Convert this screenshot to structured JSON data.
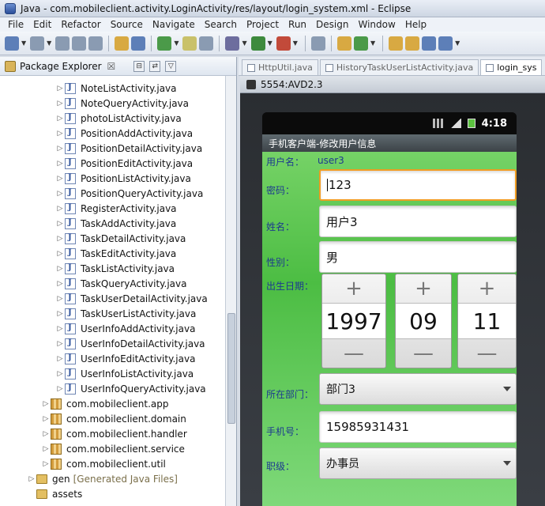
{
  "window": {
    "title": "Java - com.mobileclient.activity.LoginActivity/res/layout/login_system.xml - Eclipse"
  },
  "menu": [
    "File",
    "Edit",
    "Refactor",
    "Source",
    "Navigate",
    "Search",
    "Project",
    "Run",
    "Design",
    "Window",
    "Help"
  ],
  "explorer": {
    "title": "Package Explorer",
    "close_glyph": "☒",
    "java_files": [
      "NoteListActivity.java",
      "NoteQueryActivity.java",
      "photoListActivity.java",
      "PositionAddActivity.java",
      "PositionDetailActivity.java",
      "PositionEditActivity.java",
      "PositionListActivity.java",
      "PositionQueryActivity.java",
      "RegisterActivity.java",
      "TaskAddActivity.java",
      "TaskDetailActivity.java",
      "TaskEditActivity.java",
      "TaskListActivity.java",
      "TaskQueryActivity.java",
      "TaskUserDetailActivity.java",
      "TaskUserListActivity.java",
      "UserInfoAddActivity.java",
      "UserInfoDetailActivity.java",
      "UserInfoEditActivity.java",
      "UserInfoListActivity.java",
      "UserInfoQueryActivity.java"
    ],
    "packages": [
      "com.mobileclient.app",
      "com.mobileclient.domain",
      "com.mobileclient.handler",
      "com.mobileclient.service",
      "com.mobileclient.util"
    ],
    "gen": {
      "name": "gen",
      "note": "[Generated Java Files]"
    },
    "assets": "assets"
  },
  "editor_tabs": [
    "HttpUtil.java",
    "HistoryTaskUserListActivity.java",
    "login_sys"
  ],
  "emulator": {
    "title": "5554:AVD2.3",
    "status_time": "4:18",
    "app_title": "手机客户端-修改用户信息",
    "username_label": "用户名：",
    "username_value": "user3",
    "password_label": "密码：",
    "password_value": "123",
    "name_label": "姓名：",
    "name_value": "用户3",
    "gender_label": "性别：",
    "gender_value": "男",
    "birthday_label": "出生日期：",
    "date": {
      "year": "1997",
      "month": "09",
      "day": "11"
    },
    "spinner_plus": "+",
    "spinner_minus": "—",
    "department_label": "所在部门：",
    "department_value": "部门3",
    "phone_label": "手机号：",
    "phone_value": "15985931431",
    "rank_label": "职级：",
    "rank_value": "办事员"
  }
}
